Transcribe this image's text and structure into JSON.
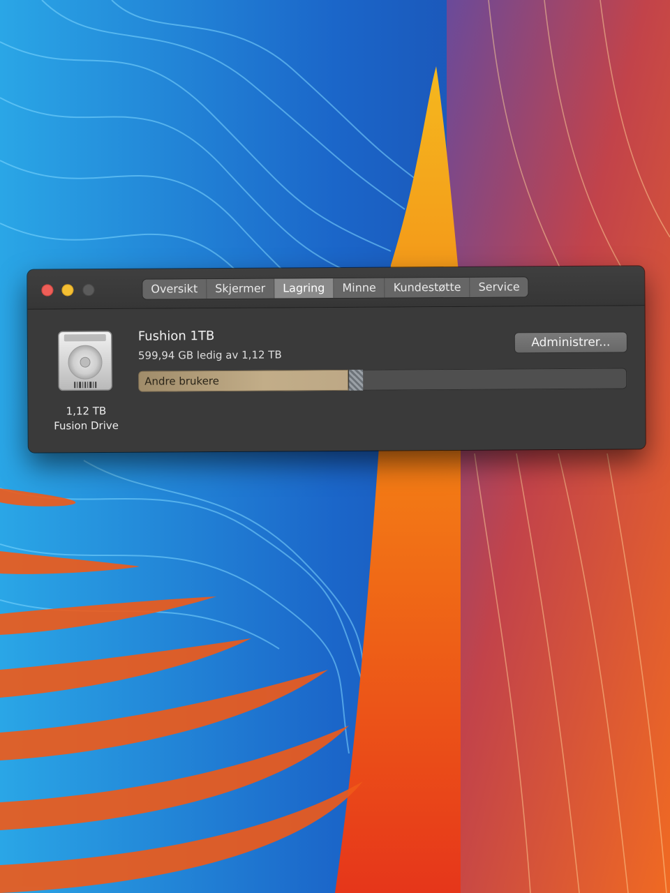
{
  "window": {
    "tabs": [
      {
        "label": "Oversikt",
        "active": false
      },
      {
        "label": "Skjermer",
        "active": false
      },
      {
        "label": "Lagring",
        "active": true
      },
      {
        "label": "Minne",
        "active": false
      },
      {
        "label": "Kundestøtte",
        "active": false
      },
      {
        "label": "Service",
        "active": false
      }
    ]
  },
  "drive": {
    "icon": "hard-drive-icon",
    "capacity": "1,12 TB",
    "type": "Fusion Drive",
    "name": "Fushion 1TB",
    "free_text": "599,94 GB ledig av 1,12 TB",
    "manage_label": "Administrer...",
    "usage": {
      "segments": [
        {
          "label": "Andre brukere",
          "fraction": 0.43,
          "color": "#c2ad88"
        },
        {
          "label": "",
          "fraction": 0.03,
          "color": "#8a9096"
        }
      ],
      "free_fraction": 0.54
    }
  },
  "colors": {
    "close": "#ee5e58",
    "minimize": "#f4bf33",
    "zoom": "#5b5b5b"
  }
}
